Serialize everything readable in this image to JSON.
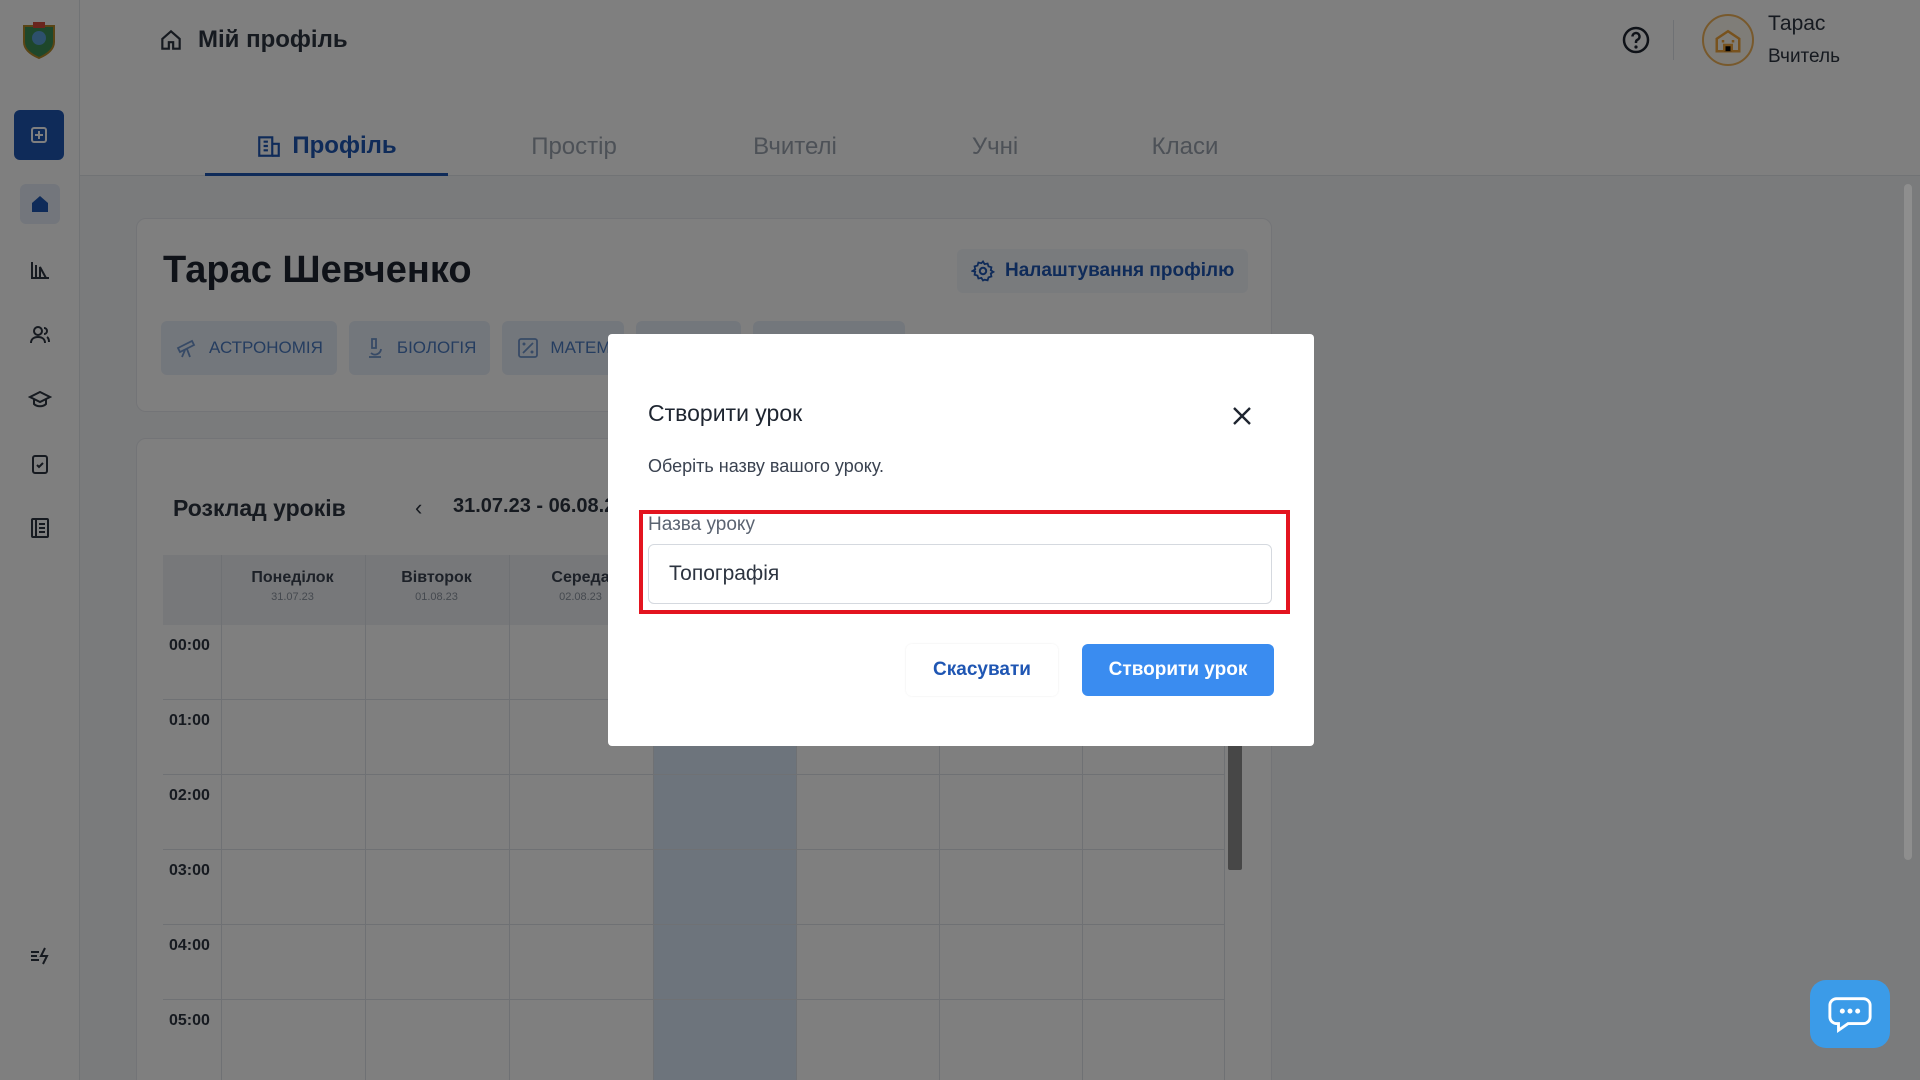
{
  "header": {
    "breadcrumb": "Мій профіль",
    "user_name": "Тарас",
    "user_role": "Вчитель"
  },
  "tabs": [
    {
      "label": "Профіль",
      "active": true
    },
    {
      "label": "Простір",
      "active": false
    },
    {
      "label": "Вчителі",
      "active": false
    },
    {
      "label": "Учні",
      "active": false
    },
    {
      "label": "Класи",
      "active": false
    }
  ],
  "profile": {
    "name": "Тарас Шевченко",
    "settings_label": "Налаштування профілю",
    "subjects": [
      "АСТРОНОМІЯ",
      "БІОЛОГІЯ",
      "МАТЕМ"
    ]
  },
  "schedule": {
    "title": "Розклад уроків",
    "prev": "‹",
    "range": "31.07.23 - 06.08.2",
    "days": [
      {
        "name": "Понеділок",
        "date": "31.07.23"
      },
      {
        "name": "Вівторок",
        "date": "01.08.23"
      },
      {
        "name": "Середа",
        "date": "02.08.23"
      }
    ],
    "hours": [
      "00:00",
      "01:00",
      "02:00",
      "03:00",
      "04:00",
      "05:00"
    ]
  },
  "modal": {
    "title": "Створити урок",
    "subtitle": "Оберіть назву вашого уроку.",
    "field_label": "Назва уроку",
    "field_value": "Топографія",
    "cancel_label": "Скасувати",
    "create_label": "Створити урок"
  },
  "colors": {
    "accent": "#1f56b3",
    "primary_button": "#3a8cf0",
    "highlight": "#e3141f",
    "chat": "#3b9be8"
  }
}
